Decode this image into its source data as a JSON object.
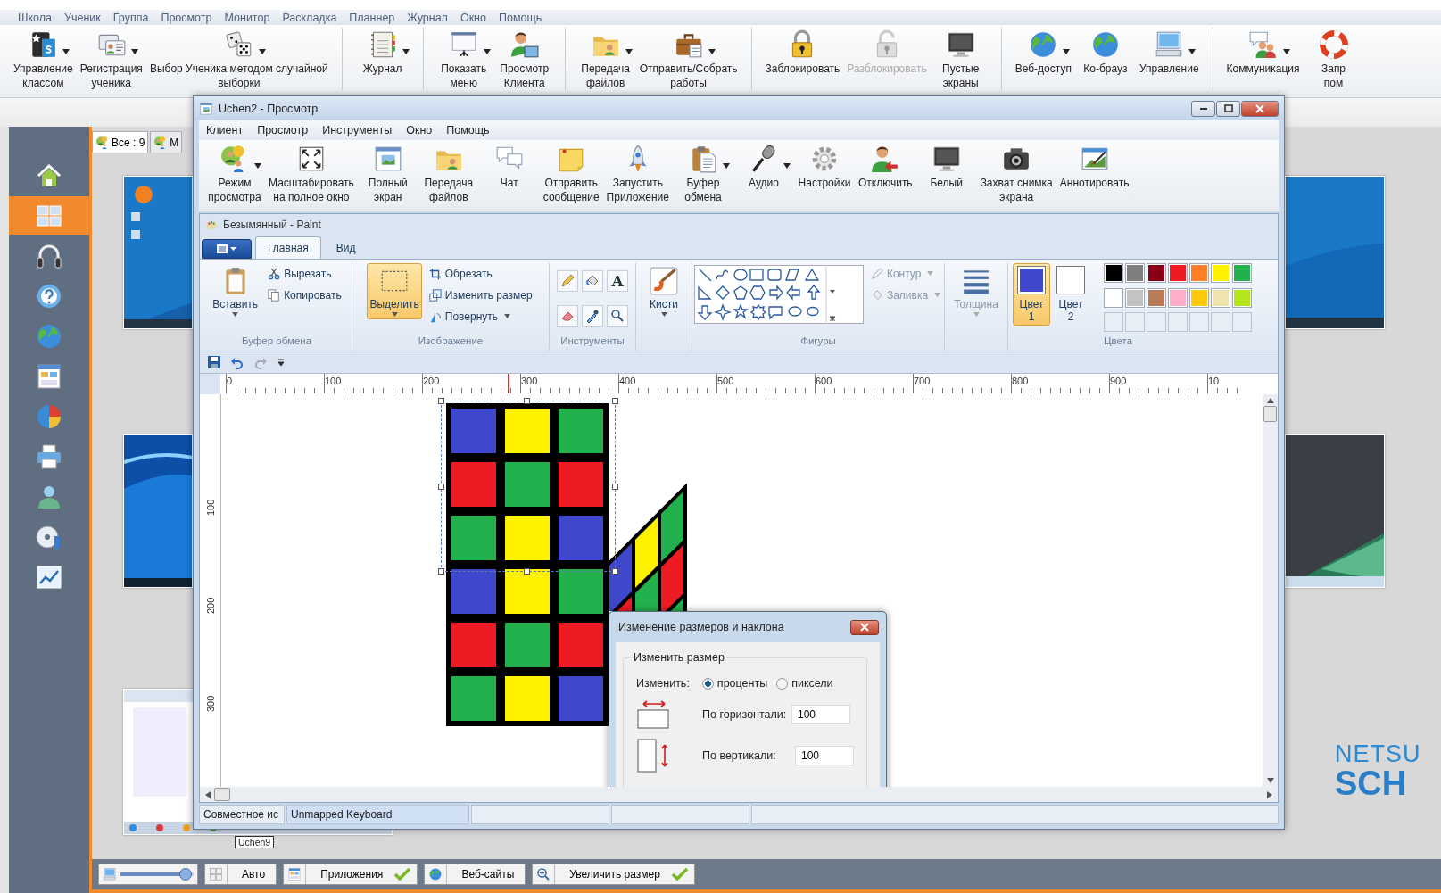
{
  "menu": [
    "Школа",
    "Ученик",
    "Группа",
    "Просмотр",
    "Монитор",
    "Раскладка",
    "Планнер",
    "Журнал",
    "Окно",
    "Помощь"
  ],
  "toolbar": [
    {
      "items": [
        {
          "lines": [
            "Управление",
            "классом"
          ],
          "dropdown": true,
          "disabled": false
        },
        {
          "lines": [
            "Регистрация",
            "ученика"
          ],
          "dropdown": true,
          "disabled": false
        },
        {
          "lines": [
            "Выбор Ученика методом случайной",
            "выборки"
          ],
          "dropdown": true,
          "disabled": false
        }
      ]
    },
    {
      "items": [
        {
          "lines": [
            "Журнал"
          ],
          "dropdown": true,
          "disabled": false
        }
      ]
    },
    {
      "items": [
        {
          "lines": [
            "Показать",
            "меню"
          ],
          "dropdown": true,
          "disabled": false
        },
        {
          "lines": [
            "Просмотр",
            "Клиента"
          ],
          "dropdown": false,
          "disabled": false
        }
      ]
    },
    {
      "items": [
        {
          "lines": [
            "Передача",
            "файлов"
          ],
          "dropdown": true,
          "disabled": false
        },
        {
          "lines": [
            "Отправить/Собрать",
            "работы"
          ],
          "dropdown": true,
          "disabled": false
        }
      ]
    },
    {
      "items": [
        {
          "lines": [
            "Заблокировать"
          ],
          "dropdown": false,
          "disabled": false
        },
        {
          "lines": [
            "Разблокировать"
          ],
          "dropdown": false,
          "disabled": true
        },
        {
          "lines": [
            "Пустые",
            "экраны"
          ],
          "dropdown": false,
          "disabled": false
        }
      ]
    },
    {
      "items": [
        {
          "lines": [
            "Веб-доступ"
          ],
          "dropdown": true,
          "disabled": false
        },
        {
          "lines": [
            "Ко-брауз"
          ],
          "dropdown": false,
          "disabled": false
        },
        {
          "lines": [
            "Управление"
          ],
          "dropdown": true,
          "disabled": false
        }
      ]
    },
    {
      "items": [
        {
          "lines": [
            "Коммуникация"
          ],
          "dropdown": true,
          "disabled": false
        },
        {
          "lines": [
            "Запр",
            "пом"
          ],
          "dropdown": false,
          "disabled": false
        }
      ]
    }
  ],
  "sidebar_items": [
    {
      "selected": false
    },
    {
      "selected": true
    },
    {
      "selected": false
    },
    {
      "selected": false
    },
    {
      "selected": false
    },
    {
      "selected": false
    },
    {
      "selected": false
    },
    {
      "selected": false
    },
    {
      "selected": false
    },
    {
      "selected": false
    },
    {
      "selected": false
    }
  ],
  "group_tabs": [
    {
      "label": "Все : 9",
      "selected": true
    },
    {
      "label": "М",
      "selected": false
    }
  ],
  "thumbnail_label": "Uchen9",
  "logo": [
    "NETSU",
    "SCH"
  ],
  "viewer": {
    "title": "Uchen2 - Просмотр",
    "menu": [
      "Клиент",
      "Просмотр",
      "Инструменты",
      "Окно",
      "Помощь"
    ],
    "toolbar": [
      {
        "lines": [
          "Режим",
          "просмотра"
        ],
        "dropdown": true
      },
      {
        "lines": [
          "Масштабировать",
          "на полное окно"
        ],
        "dropdown": false
      },
      {
        "lines": [
          "Полный",
          "экран"
        ],
        "dropdown": false
      },
      {
        "lines": [
          "Передача",
          "файлов"
        ],
        "dropdown": false
      },
      {
        "lines": [
          "Чат"
        ],
        "dropdown": false
      },
      {
        "lines": [
          "Отправить",
          "сообщение"
        ],
        "dropdown": false
      },
      {
        "lines": [
          "Запустить",
          "Приложение"
        ],
        "dropdown": false
      },
      {
        "lines": [
          "Буфер",
          "обмена"
        ],
        "dropdown": true
      },
      {
        "lines": [
          "Аудио"
        ],
        "dropdown": true
      },
      {
        "lines": [
          "Настройки"
        ],
        "dropdown": false
      },
      {
        "lines": [
          "Отключить"
        ],
        "dropdown": false
      },
      {
        "lines": [
          "Белый"
        ],
        "dropdown": false
      },
      {
        "lines": [
          "Захват снимка",
          "экрана"
        ],
        "dropdown": false
      },
      {
        "lines": [
          "Аннотировать"
        ],
        "dropdown": false
      }
    ],
    "paint": {
      "title": "Безымянный - Paint",
      "tabs": [
        {
          "label": "Главная",
          "selected": true
        },
        {
          "label": "Вид",
          "selected": false
        }
      ],
      "clipboard": {
        "paste": "Вставить",
        "cut": "Вырезать",
        "copy": "Копировать",
        "label": "Буфер обмена"
      },
      "image": {
        "select": {
          "label": "Выделить",
          "selected": true
        },
        "crop": "Обрезать",
        "resize": "Изменить размер",
        "rotate": "Повернуть",
        "label": "Изображение"
      },
      "tools": {
        "text_tool": "A",
        "label": "Инструменты"
      },
      "brushes": "Кисти",
      "shapes": {
        "outline": "Контур",
        "fill": "Заливка",
        "label": "Фигуры"
      },
      "size": "Толщина",
      "colors": [
        {
          "lines": [
            "Цвет",
            "1"
          ],
          "color": "#3f48cc",
          "selected": true
        },
        {
          "lines": [
            "Цвет",
            "2"
          ],
          "color": "#ffffff",
          "selected": false
        }
      ],
      "palette": {
        "label": "Цвета",
        "colors": [
          {
            "color": "#000000"
          },
          {
            "color": "#7f7f7f"
          },
          {
            "color": "#880015"
          },
          {
            "color": "#ed1c24"
          },
          {
            "color": "#ff7f27"
          },
          {
            "color": "#fff200"
          },
          {
            "color": "#22b14c"
          },
          {
            "color": "#ffffff"
          },
          {
            "color": "#c3c3c3"
          },
          {
            "color": "#b97a57"
          },
          {
            "color": "#ffaec9"
          },
          {
            "color": "#ffc90e"
          },
          {
            "color": "#efe4b0"
          },
          {
            "color": "#b5e61d"
          }
        ]
      },
      "ruler": [
        "0",
        "100",
        "200",
        "300",
        "400",
        "500",
        "600",
        "700",
        "800",
        "900",
        "10"
      ],
      "vruler": [
        "100",
        "200",
        "300"
      ],
      "dialog": {
        "title": "Изменение размеров и наклона",
        "group": "Изменить размер",
        "by_label": "Изменить:",
        "units": [
          {
            "label": "проценты",
            "selected": true
          },
          {
            "label": "пиксели",
            "selected": false
          }
        ],
        "fields": [
          {
            "label": "По горизонтали:",
            "value": "100"
          },
          {
            "label": "По вертикали:",
            "value": "100"
          }
        ]
      }
    },
    "status_bar": [
      "Совместное ис",
      "Unmapped Keyboard"
    ]
  },
  "bottom_bar": {
    "zoom": {
      "level": 0.88
    },
    "buttons": [
      {
        "label": "Авто",
        "kind": "plain"
      },
      {
        "label": "Приложения",
        "kind": "check",
        "checked": true
      },
      {
        "label": "Веб-сайты",
        "kind": "check",
        "checked": false
      },
      {
        "label": "Увеличить размер",
        "kind": "check",
        "checked": true
      }
    ]
  }
}
